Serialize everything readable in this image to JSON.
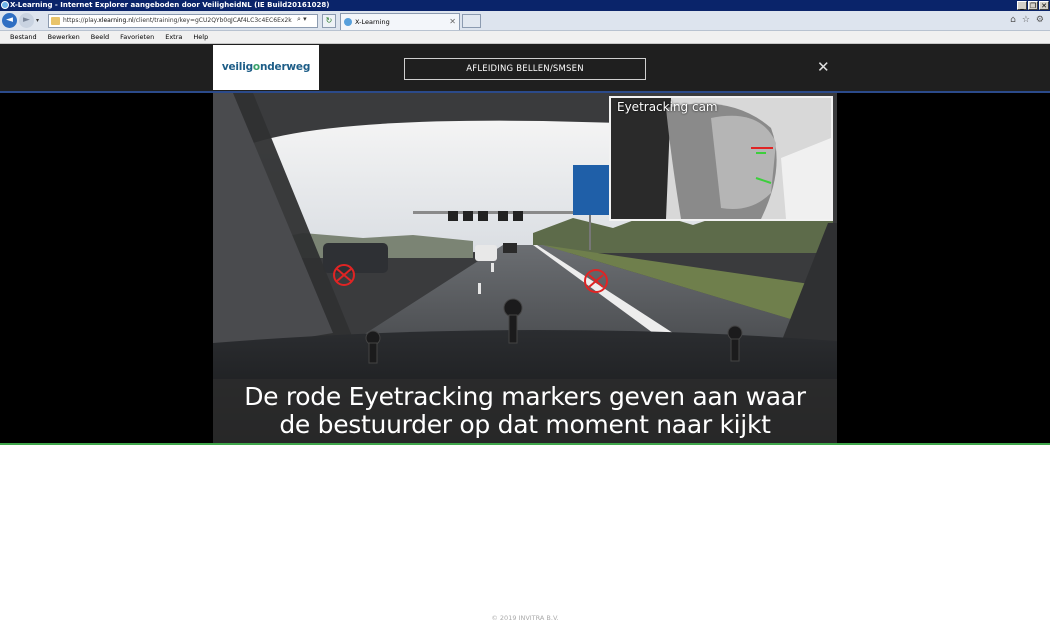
{
  "window": {
    "title": "X-Learning - Internet Explorer aangeboden door VeiligheidNL (IE Build20161028)",
    "controls": [
      "_",
      "❐",
      "✕"
    ]
  },
  "browser": {
    "address_prefix": "https://play.",
    "address_domain": "xlearning.nl",
    "address_suffix": "/client/training/key=gCU2QYb0qJCAf4LC3c4EC6Ex2k",
    "address_tools": "⌕ ▾",
    "refresh": "↻",
    "tab_title": "X-Learning",
    "tab_close": "✕",
    "back": "◄",
    "forward": "►",
    "right_tools": [
      "⌂",
      "☆",
      "⚙"
    ]
  },
  "menu": [
    "Bestand",
    "Bewerken",
    "Beeld",
    "Favorieten",
    "Extra",
    "Help"
  ],
  "app": {
    "logo_part1": "veilig",
    "logo_part2": "o",
    "logo_part3": "nderweg",
    "title": "AFLEIDING BELLEN/SMSEN",
    "close": "✕"
  },
  "video": {
    "pip_label": "Eyetracking cam",
    "caption_line1": "De rode Eyetracking markers geven aan waar",
    "caption_line2": "de bestuurder op dat moment naar kijkt"
  },
  "footer": "© 2019 INVITRA B.V."
}
